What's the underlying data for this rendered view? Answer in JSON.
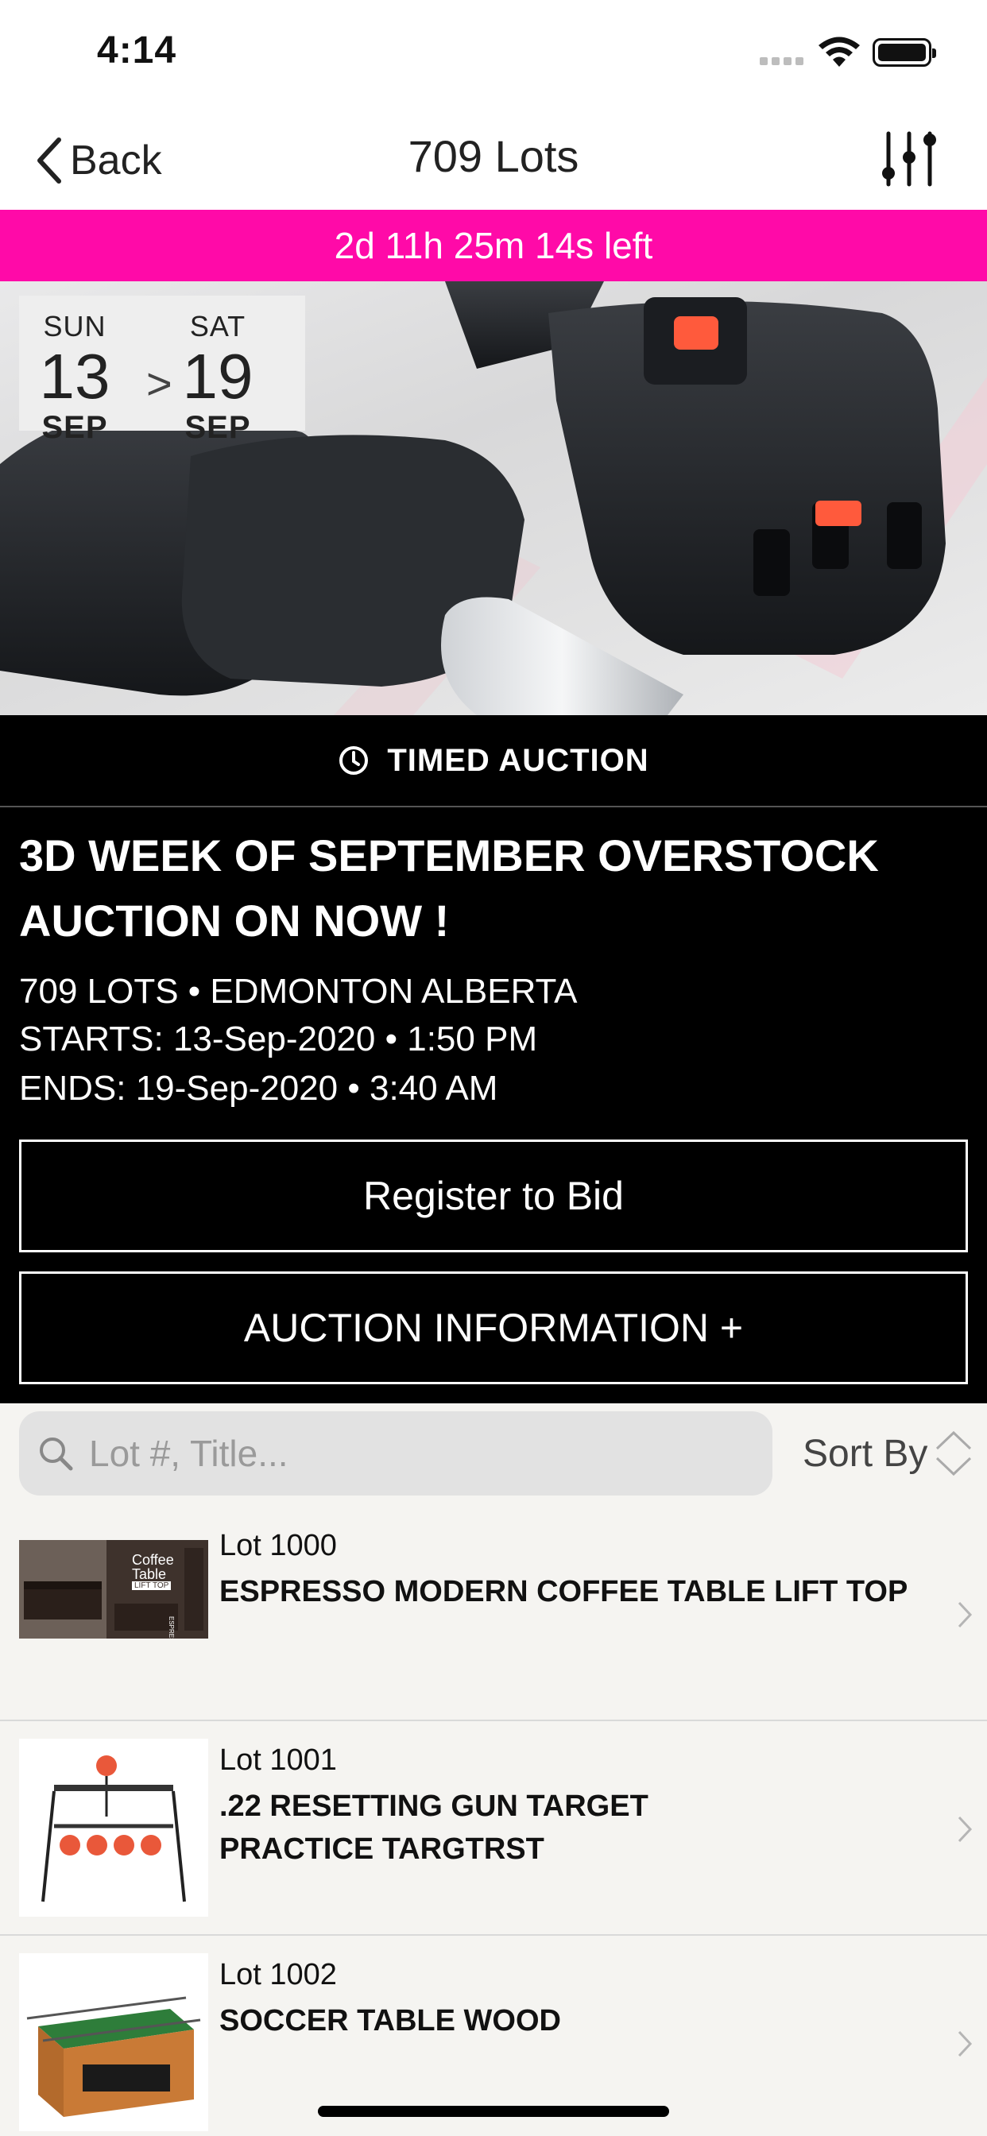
{
  "status_bar": {
    "time": "4:14"
  },
  "nav": {
    "back_label": "Back",
    "title": "709 Lots"
  },
  "countdown": "2d 11h 25m 14s left",
  "dates": {
    "start": {
      "dow": "SUN",
      "day": "13",
      "month": "SEP"
    },
    "separator": ">",
    "end": {
      "dow": "SAT",
      "day": "19",
      "month": "SEP"
    }
  },
  "auction": {
    "type_label": "TIMED AUCTION",
    "title": "3D WEEK OF SEPTEMBER OVERSTOCK AUCTION ON NOW !",
    "lots_location": "709 LOTS • EDMONTON ALBERTA",
    "starts": "STARTS: 13-Sep-2020 • 1:50 PM",
    "ends": "ENDS: 19-Sep-2020 • 3:40 AM",
    "register_label": "Register to Bid",
    "info_label": "AUCTION INFORMATION +"
  },
  "search": {
    "placeholder": "Lot #, Title...",
    "sort_label": "Sort By"
  },
  "lots": [
    {
      "number": "Lot 1000",
      "title": "ESPRESSO MODERN COFFEE TABLE LIFT TOP",
      "thumb_text": "Coffee Table",
      "thumb_sub": "LIFT TOP",
      "thumb_side": "ESPRESSO"
    },
    {
      "number": "Lot 1001",
      "title": ".22 RESETTING GUN TARGET PRACTICE TARGTRST"
    },
    {
      "number": "Lot 1002",
      "title": "SOCCER TABLE WOOD"
    }
  ],
  "colors": {
    "accent": "#ff0aa8",
    "info_bg": "#000000",
    "list_bg": "#f5f4f1"
  }
}
